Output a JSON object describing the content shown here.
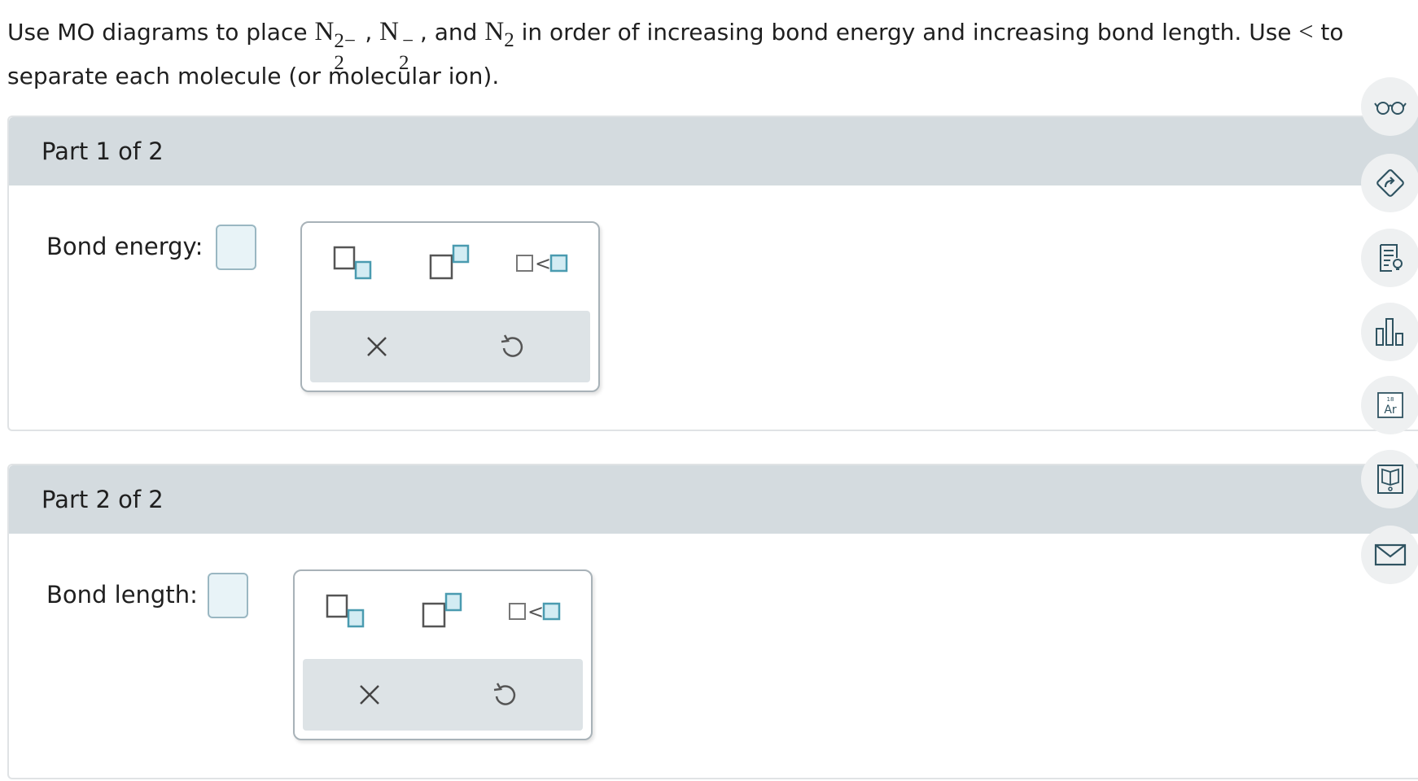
{
  "question": {
    "text_before": "Use MO diagrams to place ",
    "species1": {
      "symbol": "N",
      "sub": "2",
      "sup": "2−"
    },
    "comma1": ", ",
    "species2": {
      "symbol": "N",
      "sub": "2",
      "sup": "−"
    },
    "comma2": ",  and ",
    "species3": {
      "symbol": "N",
      "sub": "2"
    },
    "text_middle": " in order of increasing bond energy and increasing bond length. Use ",
    "lt_symbol": "<",
    "text_after": " to separate each molecule (or molecular ion)."
  },
  "parts": [
    {
      "header": "Part 1 of 2",
      "answer_label": "Bond energy:"
    },
    {
      "header": "Part 2 of 2",
      "answer_label": "Bond length:"
    }
  ],
  "palette": {
    "subscript_icon": "subscript-template-icon",
    "superscript_icon": "superscript-template-icon",
    "less_than_icon": "less-than-template-icon",
    "less_than_char": "<",
    "clear_icon": "close-icon",
    "undo_icon": "undo-icon"
  },
  "sidebar": {
    "tools": [
      "glasses-icon",
      "redo-arrow-icon",
      "hint-document-icon",
      "bar-chart-icon",
      "periodic-table-icon",
      "ebook-icon",
      "mail-icon"
    ],
    "periodic_number": "18",
    "periodic_symbol": "Ar"
  },
  "colors": {
    "header_bg": "#d4dbdf",
    "answer_fill": "#e8f3f7",
    "accent_teal": "#4a9bb0",
    "icon_stroke": "#2f5361"
  }
}
